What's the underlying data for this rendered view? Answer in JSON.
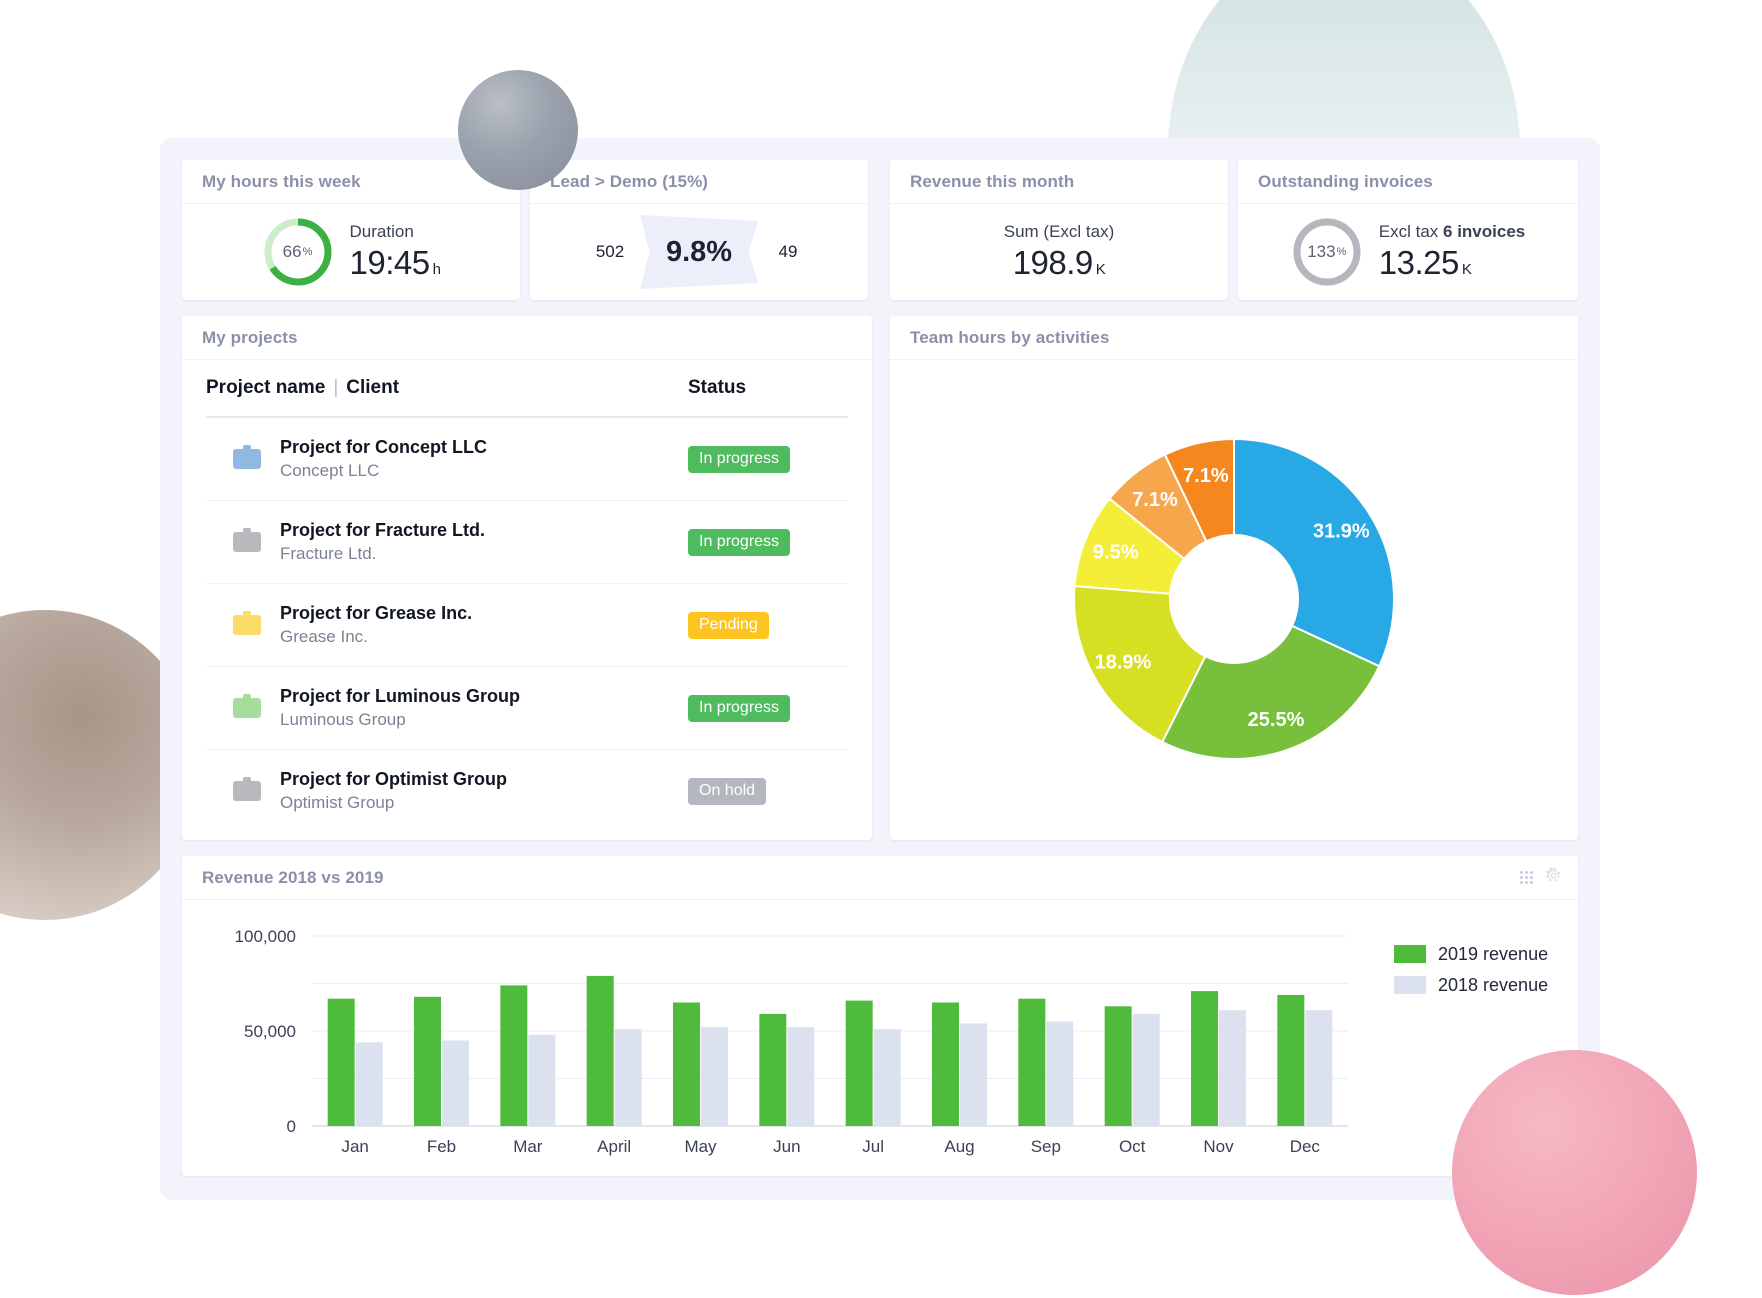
{
  "kpis": [
    {
      "title": "My hours this week",
      "type": "gauge",
      "gauge_percent": 66,
      "gauge_text": "66",
      "gauge_unit": "%",
      "gauge_color": "#3cb043",
      "gauge_track": "#cdecc9",
      "sub_label": "Duration",
      "value": "19:45",
      "unit": "h"
    },
    {
      "title": "Lead > Demo (15%)",
      "type": "funnel",
      "left_value": "502",
      "center_value": "9.8%",
      "right_value": "49"
    },
    {
      "title": "Revenue this month",
      "type": "value",
      "sub_label": "Sum (Excl tax)",
      "value": "198.9",
      "unit": "K"
    },
    {
      "title": "Outstanding invoices",
      "type": "gauge",
      "gauge_percent": 33,
      "gauge_text": "133",
      "gauge_unit": "%",
      "gauge_color": "#cf0a14",
      "gauge_track": "#b4b7bd",
      "sub_label_prefix": "Excl tax ",
      "sub_label_bold": "6 invoices",
      "value": "13.25",
      "unit": "K"
    }
  ],
  "projects": {
    "title": "My projects",
    "columns": {
      "name": "Project name",
      "separator": "|",
      "client": "Client",
      "status": "Status"
    },
    "rows": [
      {
        "name": "Project for Concept LLC",
        "client": "Concept LLC",
        "status": "In progress",
        "status_style": "badge-green",
        "icon_color": "#8fb9e0"
      },
      {
        "name": "Project for Fracture Ltd.",
        "client": "Fracture Ltd.",
        "status": "In progress",
        "status_style": "badge-green",
        "icon_color": "#b7b9bc"
      },
      {
        "name": "Project for Grease Inc.",
        "client": "Grease Inc.",
        "status": "Pending",
        "status_style": "badge-yellow",
        "icon_color": "#f9dd68"
      },
      {
        "name": "Project for Luminous Group",
        "client": "Luminous Group",
        "status": "In progress",
        "status_style": "badge-green",
        "icon_color": "#a7dd9c"
      },
      {
        "name": "Project for Optimist Group",
        "client": "Optimist Group",
        "status": "On hold",
        "status_style": "badge-grey",
        "icon_color": "#b7b9bc"
      }
    ]
  },
  "activities": {
    "title": "Team hours by activities"
  },
  "revenue": {
    "title": "Revenue 2018 vs 2019",
    "tools": {
      "drag": "drag-handle",
      "settings": "settings"
    }
  },
  "chart_data": [
    {
      "type": "pie",
      "title": "Team hours by activities",
      "subtype": "donut",
      "labels": [
        "31.9%",
        "25.5%",
        "18.9%",
        "9.5%",
        "7.1%",
        "7.1%"
      ],
      "values": [
        31.9,
        25.5,
        18.9,
        9.5,
        7.1,
        7.1
      ],
      "colors": [
        "#28a8e5",
        "#78bf3c",
        "#d7df23",
        "#f4ee38",
        "#f7a74b",
        "#f4881f"
      ],
      "legend": "none",
      "start_angle": 0,
      "direction": "clockwise",
      "inner_radius_ratio": 0.4
    },
    {
      "type": "bar",
      "title": "Revenue 2018 vs 2019",
      "categories": [
        "Jan",
        "Feb",
        "Mar",
        "April",
        "May",
        "Jun",
        "Jul",
        "Aug",
        "Sep",
        "Oct",
        "Nov",
        "Dec"
      ],
      "series": [
        {
          "name": "2019 revenue",
          "color": "#4fbb3c",
          "values": [
            67000,
            68000,
            74000,
            79000,
            65000,
            59000,
            66000,
            65000,
            67000,
            63000,
            71000,
            69000
          ]
        },
        {
          "name": "2018 revenue",
          "color": "#dbe1ef",
          "values": [
            44000,
            45000,
            48000,
            51000,
            52000,
            52000,
            51000,
            54000,
            55000,
            59000,
            61000,
            61000
          ]
        }
      ],
      "ylabel": "",
      "xlabel": "",
      "ylim": [
        0,
        100000
      ],
      "yticks": [
        0,
        50000,
        100000
      ],
      "ytick_labels": [
        "0",
        "50,000",
        "100,000"
      ],
      "grid": true,
      "legend": "right"
    }
  ]
}
